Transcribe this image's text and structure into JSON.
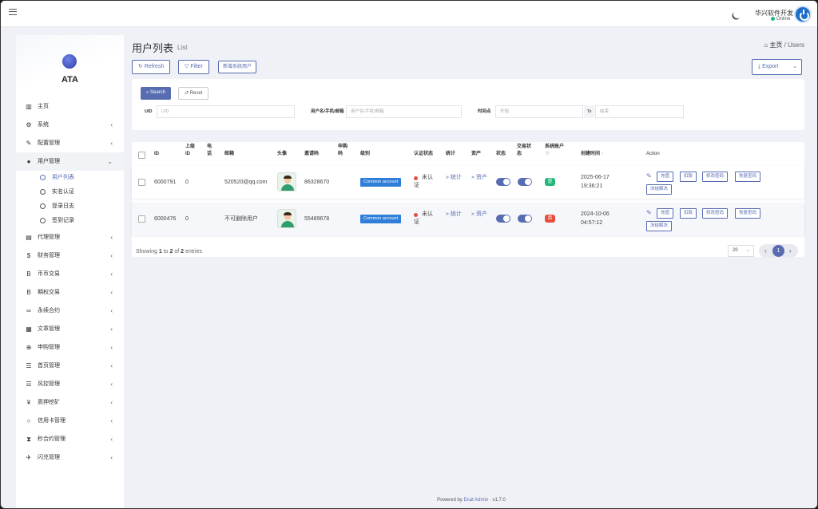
{
  "topbar": {
    "user_name": "华兴软件开发",
    "status": "Online"
  },
  "brand": {
    "name": "ATA"
  },
  "sidebar": {
    "items": [
      {
        "label": "主页",
        "icon": "bar-chart-icon",
        "chevron": ""
      },
      {
        "label": "系统",
        "icon": "gear-icon",
        "chevron": "‹"
      },
      {
        "label": "配置管理",
        "icon": "wrench-icon",
        "chevron": "‹"
      },
      {
        "label": "用户管理",
        "icon": "user-icon",
        "chevron": "⌄"
      },
      {
        "label": "代理管理",
        "icon": "id-card-icon",
        "chevron": "‹"
      },
      {
        "label": "财务管理",
        "icon": "dollar-icon",
        "chevron": "‹"
      },
      {
        "label": "币币交易",
        "icon": "bitcoin-icon",
        "chevron": "‹"
      },
      {
        "label": "期权交易",
        "icon": "bitcoin-icon",
        "chevron": "‹"
      },
      {
        "label": "永续合约",
        "icon": "link-icon",
        "chevron": "‹"
      },
      {
        "label": "文章管理",
        "icon": "newspaper-icon",
        "chevron": "‹"
      },
      {
        "label": "申购管理",
        "icon": "lifebuoy-icon",
        "chevron": "‹"
      },
      {
        "label": "首页管理",
        "icon": "list-icon",
        "chevron": "‹"
      },
      {
        "label": "风控管理",
        "icon": "list-icon",
        "chevron": "‹"
      },
      {
        "label": "质押挖矿",
        "icon": "yen-icon",
        "chevron": "‹"
      },
      {
        "label": "信用卡管理",
        "icon": "circle-icon",
        "chevron": "‹"
      },
      {
        "label": "秒合约管理",
        "icon": "hourglass-icon",
        "chevron": "‹"
      },
      {
        "label": "闪兑管理",
        "icon": "plane-icon",
        "chevron": "‹"
      }
    ],
    "user_sub": [
      "用户列表",
      "实名认证",
      "登录日志",
      "签到记录"
    ]
  },
  "page": {
    "title": "用户列表",
    "subtitle": "List",
    "breadcrumb_home": "主页",
    "breadcrumb_sep": "/",
    "breadcrumb_current": "Users"
  },
  "toolbar": {
    "refresh": "Refresh",
    "filter": "Filter",
    "new_system_user": "新增系统用户",
    "export": "Export"
  },
  "filter": {
    "search": "Search",
    "reset": "Reset",
    "uid_label": "UID",
    "uid_placeholder": "UID",
    "account_label": "用户名/手机/邮箱",
    "account_placeholder": "用户名/手机/邮箱",
    "time_label": "时间点",
    "time_from_placeholder": "开始",
    "time_to": "To",
    "time_to_placeholder": "结束"
  },
  "table": {
    "headers": {
      "id": "ID",
      "parent_id": "上级 ID",
      "phone": "电话",
      "email": "邮箱",
      "avatar": "头像",
      "invite": "邀请码",
      "subscribe": "申购 码",
      "level": "级别",
      "auth": "认证状态",
      "stats": "统计",
      "assets": "资产",
      "status": "状态",
      "trade_status": "交易状 态",
      "system_user": "系统账户",
      "created": "创建时间",
      "action": "Action"
    },
    "rows": [
      {
        "id": "6000791",
        "parent_id": "0",
        "phone": "",
        "email": "520520@qq.com",
        "invite": "86328670",
        "level": "Common account",
        "auth": "未认证",
        "stats": "» 统计",
        "assets": "» 资产",
        "status_on": true,
        "trade_on": true,
        "system_tag": "是",
        "system_color": "#21b978",
        "created_date": "2025-06-17",
        "created_time": "19:36:21"
      },
      {
        "id": "6000476",
        "parent_id": "0",
        "phone": "",
        "email": "不可删除用户",
        "invite": "55489678",
        "level": "Common account",
        "auth": "未认证",
        "stats": "» 统计",
        "assets": "» 资产",
        "status_on": true,
        "trade_on": true,
        "system_tag": "否",
        "system_color": "#e74c3c",
        "created_date": "2024-10-06",
        "created_time": "04:57:12"
      }
    ],
    "actions": [
      "充值",
      "扣款",
      "修改密码",
      "恢复密码",
      "冻结解冻"
    ]
  },
  "pagination": {
    "showing_prefix": "Showing",
    "from": "1",
    "to_word": "to",
    "to": "2",
    "of_word": "of",
    "total": "2",
    "entries_word": "entries",
    "per_page": "20",
    "current_page": "1"
  },
  "footer": {
    "prefix": "Powered by",
    "link": "Dcat Admin",
    "sep": "·",
    "version": "v1.7.0"
  },
  "colors": {
    "accent": "#586cb1",
    "level_badge": "#2f7ed8",
    "online": "#21b978",
    "unverified": "#e74c3c"
  }
}
